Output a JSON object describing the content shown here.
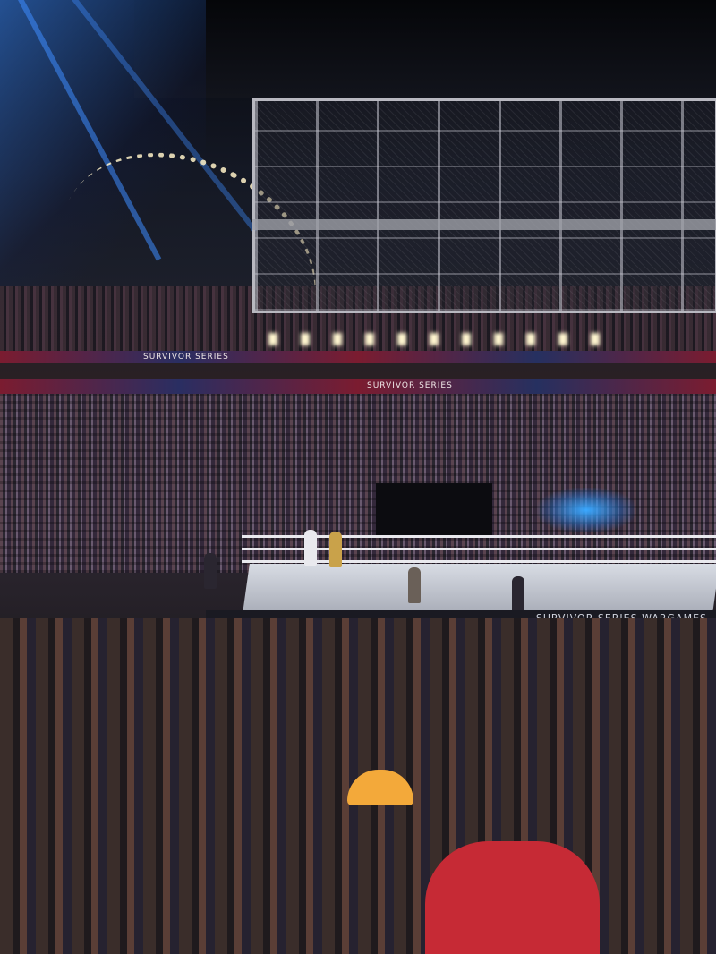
{
  "scene": {
    "ribbon_text_1": "SURVIVOR SERIES",
    "ribbon_text_2": "SURVIVOR SERIES",
    "apron_text": "SURVIVOR SERIES WARGAMES"
  }
}
